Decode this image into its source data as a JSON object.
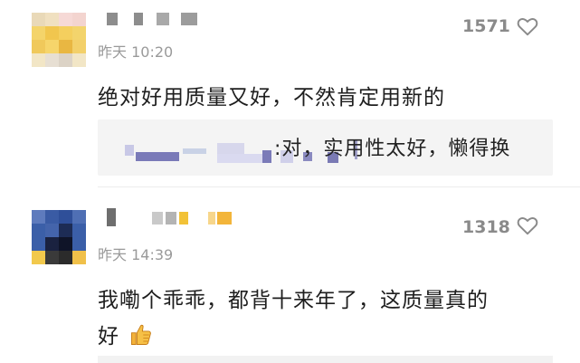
{
  "comments": [
    {
      "time": "昨天 10:20",
      "likes": "1571",
      "text": "绝对好用质量又好，不然肯定用新的",
      "reply_text": ":对，实用性太好，懒得换",
      "icons": {
        "like": "heart-outline-icon"
      }
    },
    {
      "time": "昨天 14:39",
      "likes": "1318",
      "text_line1": "我嘞个乖乖，都背十来年了，这质量真的",
      "text_line2": "好",
      "emoji": "thumbs-up-emoji",
      "icons": {
        "like": "heart-outline-icon"
      }
    }
  ],
  "colors": {
    "avatar1": "#e8c46a",
    "avatar2": "#3b5fa8",
    "heart": "#8a8a8a"
  }
}
